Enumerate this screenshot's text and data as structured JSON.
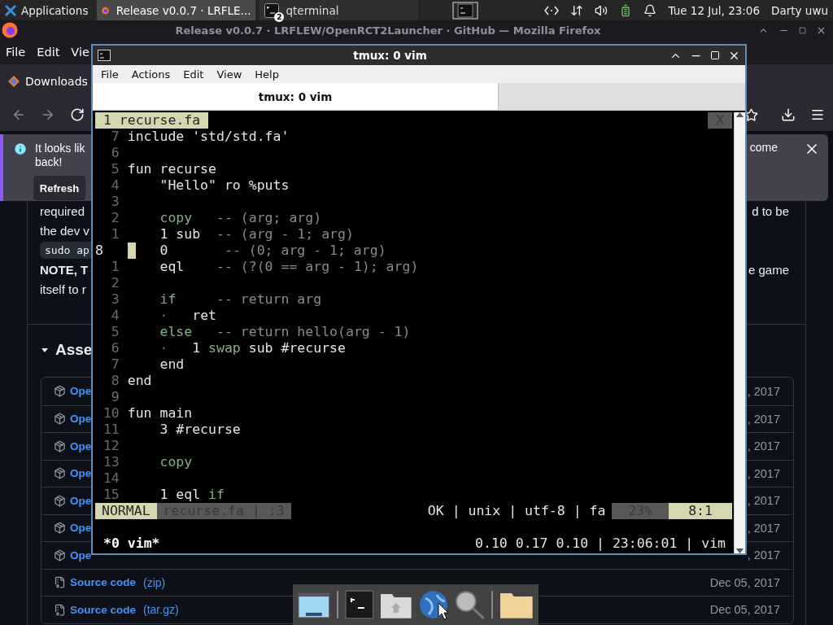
{
  "top_panel": {
    "app_menu": "Applications",
    "tasks": [
      {
        "kind": "browser",
        "label": "Release v0.0.7 · LRFLE...",
        "selected": true
      },
      {
        "kind": "terminal",
        "label": "qterminal",
        "badge": "2",
        "selected": false
      }
    ],
    "clock": "Tue 12 Jul, 23:06",
    "user": "Darty uwu"
  },
  "browser": {
    "title": "Release v0.0.7 · LRFLEW/OpenRCT2Launcher · GitHub — Mozilla Firefox",
    "menu": [
      "File",
      "Edit",
      "Vie"
    ],
    "bookmark": "Downloads",
    "notification": {
      "left_lines": [
        "It looks lik",
        "back!"
      ],
      "right_text": "come",
      "button": "Refresh"
    },
    "paragraph": [
      {
        "kind": "text",
        "left": "required",
        "right": "d to be"
      },
      {
        "kind": "text",
        "left": "the dev v"
      },
      {
        "kind": "code",
        "left": "sudo ap"
      },
      {
        "kind": "bold",
        "left": "NOTE, T",
        "right": "e game"
      },
      {
        "kind": "text",
        "left": "itself to r"
      }
    ],
    "assets": {
      "heading": "Asse",
      "expanded": true,
      "rows": [
        {
          "kind": "package",
          "name": "Ope",
          "date": ", 2017"
        },
        {
          "kind": "package",
          "name": "Ope",
          "date": ", 2017"
        },
        {
          "kind": "package",
          "name": "Ope",
          "date": ", 2017"
        },
        {
          "kind": "package",
          "name": "Ope",
          "date": ", 2017"
        },
        {
          "kind": "package",
          "name": "Ope",
          "date": ", 2017"
        },
        {
          "kind": "package",
          "name": "Ope",
          "date": ", 2017"
        },
        {
          "kind": "package",
          "name": "Ope",
          "date": ", 2017"
        },
        {
          "kind": "source",
          "name": "Source code",
          "format": "(zip)",
          "date": "Dec 05, 2017"
        },
        {
          "kind": "source",
          "name": "Source code",
          "format": "(tar.gz)",
          "date": "Dec 05, 2017"
        }
      ]
    }
  },
  "terminal": {
    "title": "tmux: 0 vim",
    "menu": [
      "File",
      "Actions",
      "Edit",
      "View",
      "Help"
    ],
    "tabs": [
      {
        "label": "tmux: 0 vim",
        "selected": true
      }
    ],
    "vim": {
      "tab": "1 recurse.fa",
      "close": "X",
      "lines": [
        {
          "number": "7",
          "cursor": false,
          "tokens": [
            {
              "kind": "plain",
              "text": "include 'std/std.fa'"
            }
          ]
        },
        {
          "number": "6",
          "cursor": false
        },
        {
          "number": "5",
          "cursor": false,
          "tokens": [
            {
              "kind": "plain",
              "text": "fun recurse"
            }
          ]
        },
        {
          "number": "4",
          "cursor": false,
          "tokens": [
            {
              "kind": "plain",
              "text": "    \"Hello\" ro %puts"
            }
          ]
        },
        {
          "number": "3",
          "cursor": false
        },
        {
          "number": "2",
          "cursor": false,
          "tokens": [
            {
              "kind": "keyword",
              "text": "    copy"
            },
            {
              "kind": "comment",
              "text": "   -- (arg; arg)"
            }
          ]
        },
        {
          "number": "1",
          "cursor": false,
          "tokens": [
            {
              "kind": "plain",
              "text": "    1 sub"
            },
            {
              "kind": "comment",
              "text": "  -- (arg - 1; arg)"
            }
          ]
        },
        {
          "number": "8",
          "cursor": true,
          "tokens": [
            {
              "kind": "plain",
              "text": "    0"
            },
            {
              "kind": "comment",
              "text": "       -- (0; arg - 1; arg)"
            }
          ]
        },
        {
          "number": "1",
          "cursor": false,
          "tokens": [
            {
              "kind": "plain",
              "text": "    eql"
            },
            {
              "kind": "comment",
              "text": "    -- (?(0 == arg - 1); arg)"
            }
          ]
        },
        {
          "number": "2",
          "cursor": false
        },
        {
          "number": "3",
          "cursor": false,
          "tokens": [
            {
              "kind": "keyword",
              "text": "    if"
            },
            {
              "kind": "comment",
              "text": "     -- return arg"
            }
          ]
        },
        {
          "number": "4",
          "cursor": false,
          "tokens": [
            {
              "kind": "dim",
              "text": "    ·"
            },
            {
              "kind": "plain",
              "text": "   ret"
            }
          ]
        },
        {
          "number": "5",
          "cursor": false,
          "tokens": [
            {
              "kind": "keyword",
              "text": "    else"
            },
            {
              "kind": "comment",
              "text": "   -- return hello(arg - 1)"
            }
          ]
        },
        {
          "number": "6",
          "cursor": false,
          "tokens": [
            {
              "kind": "dim",
              "text": "    ·"
            },
            {
              "kind": "plain",
              "text": "   1 "
            },
            {
              "kind": "keyword",
              "text": "swap"
            },
            {
              "kind": "plain",
              "text": " sub #recurse"
            }
          ]
        },
        {
          "number": "7",
          "cursor": false,
          "tokens": [
            {
              "kind": "plain",
              "text": "    end"
            }
          ]
        },
        {
          "number": "8",
          "cursor": false,
          "tokens": [
            {
              "kind": "plain",
              "text": "end"
            }
          ]
        },
        {
          "number": "9",
          "cursor": false
        },
        {
          "number": "10",
          "cursor": false,
          "tokens": [
            {
              "kind": "plain",
              "text": "fun main"
            }
          ]
        },
        {
          "number": "11",
          "cursor": false,
          "tokens": [
            {
              "kind": "plain",
              "text": "    3 #recurse"
            }
          ]
        },
        {
          "number": "12",
          "cursor": false
        },
        {
          "number": "13",
          "cursor": false,
          "tokens": [
            {
              "kind": "keyword",
              "text": "    copy"
            }
          ]
        },
        {
          "number": "14",
          "cursor": false
        },
        {
          "number": "15",
          "cursor": false,
          "tokens": [
            {
              "kind": "plain",
              "text": "    1 eql "
            },
            {
              "kind": "keyword",
              "text": "if"
            }
          ]
        }
      ],
      "status": {
        "mode": "NORMAL",
        "file": "recurse.fa | :3",
        "info": "OK | unix | utf-8 | fa",
        "percent": "23%",
        "position": "8:1"
      }
    },
    "tmux_status": {
      "left": "*0 vim*",
      "right": "0.10 0.17 0.10 | 23:06:01 | vim"
    }
  }
}
